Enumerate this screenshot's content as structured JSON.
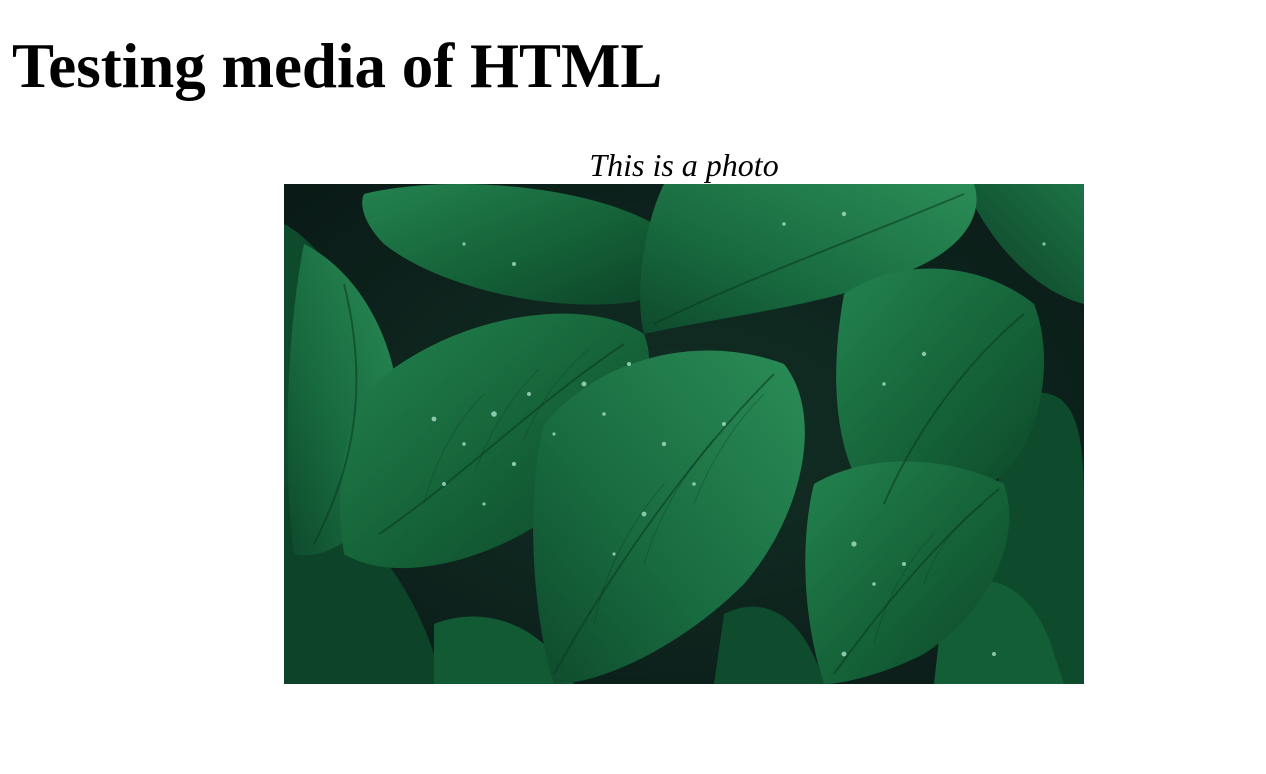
{
  "page": {
    "title": "Testing media of HTML"
  },
  "figure": {
    "caption": "This is a photo",
    "image": {
      "subject": "dark green hosta leaves with water droplets",
      "colors": {
        "background": "#0f211c",
        "leaf_dark": "#0d4a2c",
        "leaf_mid": "#17653c",
        "leaf_light": "#2a8a55",
        "vein": "#0a3a22",
        "droplet": "#9fd8c0"
      }
    }
  }
}
